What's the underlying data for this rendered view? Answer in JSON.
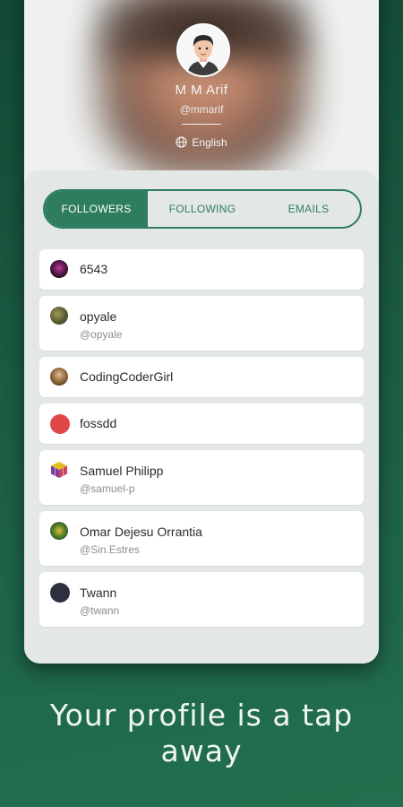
{
  "profile": {
    "name": "M M Arif",
    "handle": "@mmarif",
    "language": "English"
  },
  "tabs": [
    {
      "label": "FOLLOWERS",
      "active": true
    },
    {
      "label": "FOLLOWING",
      "active": false
    },
    {
      "label": "EMAILS",
      "active": false
    }
  ],
  "followers": [
    {
      "name": "6543",
      "handle": "",
      "avatar_color": "#3a1030"
    },
    {
      "name": "opyale",
      "handle": "@opyale",
      "avatar_color": "#6b6a3a"
    },
    {
      "name": "CodingCoderGirl",
      "handle": "",
      "avatar_color": "#8a6a3c"
    },
    {
      "name": "fossdd",
      "handle": "",
      "avatar_color": "#e04848"
    },
    {
      "name": "Samuel Philipp",
      "handle": "@samuel-p",
      "avatar_color": "#7a4fa0"
    },
    {
      "name": "Omar Dejesu Orrantia",
      "handle": "@Sin.Estres",
      "avatar_color": "#4d7a2c"
    },
    {
      "name": "Twann",
      "handle": "@twann",
      "avatar_color": "#2f3140"
    }
  ],
  "tagline": [
    "Your profile is a tap",
    "away"
  ],
  "colors": {
    "accent": "#2f7d5f",
    "background_dark": "#124a35",
    "panel": "#e3e7e5"
  }
}
